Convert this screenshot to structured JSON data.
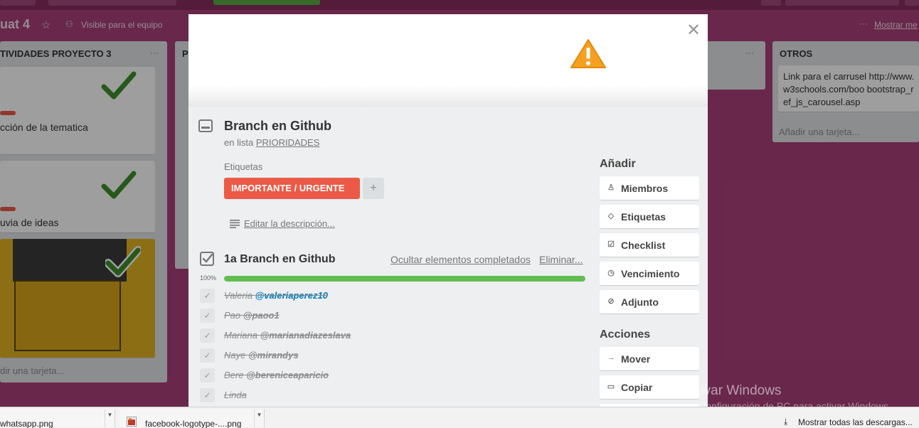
{
  "board": {
    "title": "uat 4",
    "visibility": "Visible para el equipo",
    "menu": "Mostrar me",
    "lists": [
      {
        "title": "TIVIDADES PROYECTO 3",
        "cards": [
          "cción de la tematica",
          "uvia de ideas"
        ],
        "add": "dir una tarjeta..."
      },
      {
        "title": "P"
      },
      {
        "title": "OTROS",
        "cards": [
          "Link para el carrusel http://www.w3schools.com/boo bootstrap_ref_js_carousel.asp"
        ],
        "add": "Añadir una tarjeta..."
      }
    ]
  },
  "modal": {
    "close_icon": "close-icon",
    "card_title": "Branch en Github",
    "in_list_prefix": "en lista",
    "in_list_name": "PRIORIDADES",
    "labels_heading": "Etiquetas",
    "label": "IMPORTANTE / URGENTE",
    "label_color": "#eb5a46",
    "label_add": "+",
    "edit_description": "Editar la descripción...",
    "checklist": {
      "title": "1a Branch en Github",
      "hide_completed": "Ocultar elementos completados",
      "delete": "Eliminar...",
      "progress_label": "100%",
      "progress": 1.0,
      "items": [
        {
          "name": "Valeria",
          "handle": "@valeriaperez10",
          "linked": true
        },
        {
          "name": "Pao",
          "handle": "@paoo1",
          "linked": false
        },
        {
          "name": "Mariana",
          "handle": "@marianadiazeslava",
          "linked": false
        },
        {
          "name": "Naye",
          "handle": "@mirandys",
          "linked": false
        },
        {
          "name": "Bere",
          "handle": "@bereniceaparicio",
          "linked": false
        },
        {
          "name": "Linda",
          "handle": "",
          "linked": false
        }
      ]
    },
    "sidebar": {
      "add_heading": "Añadir",
      "add_buttons": [
        "Miembros",
        "Etiquetas",
        "Checklist",
        "Vencimiento",
        "Adjunto"
      ],
      "actions_heading": "Acciones",
      "action_buttons": [
        "Mover",
        "Copiar"
      ]
    }
  },
  "watermark": {
    "line1": "Activar Windows",
    "line2": "Ir a Configuración de PC para activar Windows."
  },
  "downloads": {
    "items": [
      "whatsapp.png",
      "facebook-logotype-....png"
    ],
    "show_all": "Mostrar todas las descargas..."
  },
  "colors": {
    "board_bg": "#a9407a",
    "progress_green": "#61bd4f",
    "link_blue": "#0079bf"
  }
}
